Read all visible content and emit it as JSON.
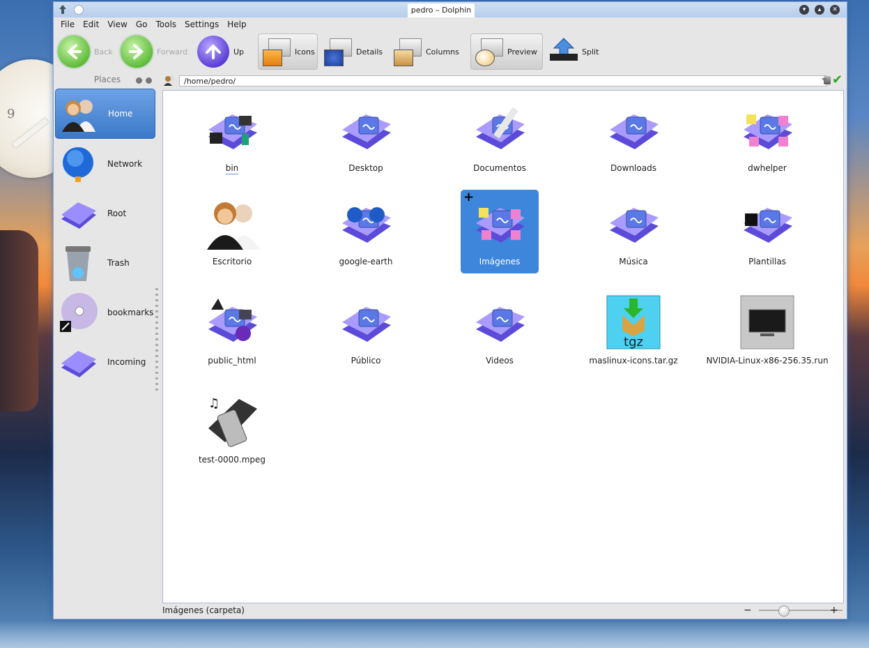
{
  "window": {
    "title": "pedro – Dolphin"
  },
  "menu": [
    "File",
    "Edit",
    "View",
    "Go",
    "Tools",
    "Settings",
    "Help"
  ],
  "toolbar": {
    "back": "Back",
    "forward": "Forward",
    "up": "Up",
    "icons": "Icons",
    "details": "Details",
    "columns": "Columns",
    "preview": "Preview",
    "split": "Split"
  },
  "places": {
    "title": "Places",
    "items": [
      "Home",
      "Network",
      "Root",
      "Trash",
      "bookmarks",
      "Incoming"
    ]
  },
  "location": {
    "path": "/home/pedro/"
  },
  "files": [
    {
      "name": "bin",
      "type": "folder-special"
    },
    {
      "name": "Desktop",
      "type": "folder"
    },
    {
      "name": "Documentos",
      "type": "folder-documents"
    },
    {
      "name": "Downloads",
      "type": "folder"
    },
    {
      "name": "dwhelper",
      "type": "folder-images"
    },
    {
      "name": "Escritorio",
      "type": "user-home"
    },
    {
      "name": "google-earth",
      "type": "folder-earth"
    },
    {
      "name": "Imágenes",
      "type": "folder-images",
      "selected": true
    },
    {
      "name": "Música",
      "type": "folder"
    },
    {
      "name": "Plantillas",
      "type": "folder-templates"
    },
    {
      "name": "public_html",
      "type": "folder-web"
    },
    {
      "name": "Público",
      "type": "folder"
    },
    {
      "name": "Videos",
      "type": "folder"
    },
    {
      "name": "maslinux-icons.tar.gz",
      "type": "archive-tgz"
    },
    {
      "name": "NVIDIA-Linux-x86-256.35.run",
      "type": "executable"
    },
    {
      "name": "test-0000.mpeg",
      "type": "video"
    }
  ],
  "status": {
    "text": "Imágenes (carpeta)",
    "zoom_minus": "−",
    "zoom_plus": "+"
  },
  "colors": {
    "accent": "#3d86db",
    "folder": "#7a6af0",
    "selection": "#3a79c8"
  },
  "archive_label": "tgz",
  "clock_numeral": "9"
}
